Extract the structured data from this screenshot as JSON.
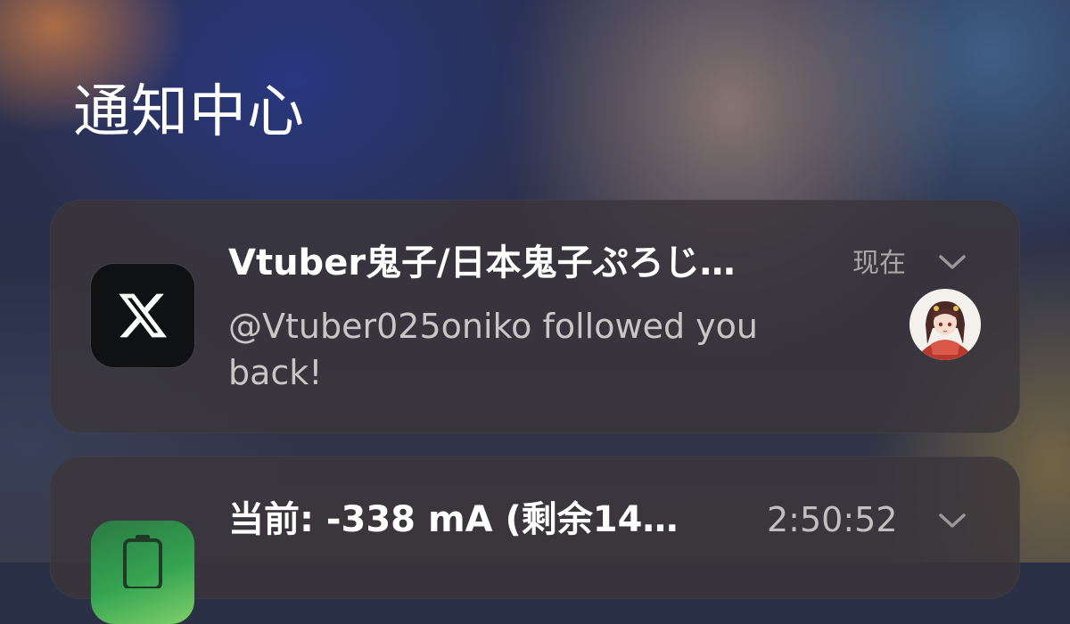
{
  "page": {
    "title": "通知中心"
  },
  "notifications": [
    {
      "app_icon": "x-logo-icon",
      "title": "Vtuber鬼子/日本鬼子ぷろじ…",
      "time": "现在",
      "body": "@Vtuber025oniko followed you back!",
      "has_avatar": true
    },
    {
      "app_icon": "battery-icon",
      "title": "当前: -338 mA (剩余14…",
      "time": "2:50:52"
    }
  ],
  "colors": {
    "card_background": "#3a363a",
    "title_text": "#ffffff",
    "body_text": "#c9c6c6",
    "muted_text": "#a9a6a6",
    "x_icon_bg": "#0f1114",
    "battery_icon_green": "#35a451"
  }
}
